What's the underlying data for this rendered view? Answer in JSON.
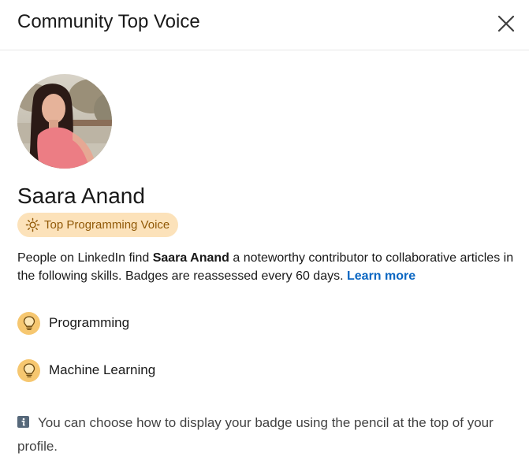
{
  "modal": {
    "title": "Community Top Voice",
    "close_icon": "close-icon"
  },
  "profile": {
    "name": "Saara Anand",
    "avatar_icon": "profile-photo"
  },
  "badge": {
    "label": "Top Programming Voice",
    "icon": "lightbulb-icon"
  },
  "description": {
    "prefix": "People on LinkedIn find ",
    "name": "Saara Anand",
    "suffix": " a noteworthy contributor to collaborative articles in the following skills. Badges are reassessed every 60 days. ",
    "link": "Learn more"
  },
  "skills": [
    {
      "label": "Programming",
      "icon": "lightbulb-icon"
    },
    {
      "label": "Machine Learning",
      "icon": "lightbulb-icon"
    }
  ],
  "info": {
    "text": "You can choose how to display your badge using the pencil at the top of your profile.",
    "icon": "info-icon"
  },
  "colors": {
    "badge_bg": "#fce2ba",
    "badge_text": "#915907",
    "skill_icon_bg": "#f6c770",
    "link": "#0a66c2"
  }
}
